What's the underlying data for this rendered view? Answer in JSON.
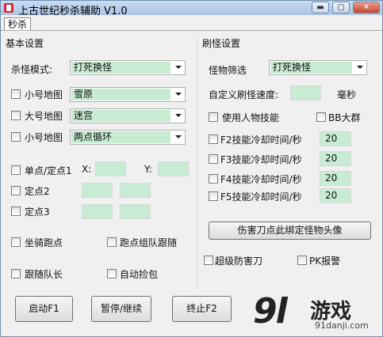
{
  "window": {
    "title": "上古世纪秒杀辅助 V1.0",
    "min": "▬",
    "max": "▢",
    "close": "✕"
  },
  "tab": {
    "label": "秒杀"
  },
  "left": {
    "title": "基本设置",
    "kill_mode_label": "杀怪模式:",
    "kill_mode_value": "打死换怪",
    "maps": [
      {
        "label": "小号地图",
        "value": "雪原"
      },
      {
        "label": "大号地图",
        "value": "迷宫"
      },
      {
        "label": "小号地图",
        "value": "两点循环"
      }
    ],
    "point_options": [
      {
        "label": "单点/定点1",
        "x_label": "X:",
        "y_label": "Y:"
      },
      {
        "label": "定点2"
      },
      {
        "label": "定点3"
      }
    ],
    "mount_run": "坐骑跑点",
    "team_follow_run": "跑点组队跟随",
    "follow_leader": "跟随队长",
    "auto_loot": "自动捡包"
  },
  "right": {
    "title": "刷怪设置",
    "filter_label": "怪物筛选",
    "filter_value": "打死换怪",
    "custom_speed_label": "自定义刷怪速度:",
    "custom_speed_unit": "毫秒",
    "use_skills": "使用人物技能",
    "bb_group": "BB大群",
    "skills": [
      {
        "label": "F2技能冷却时间/秒",
        "value": "20"
      },
      {
        "label": "F3技能冷却时间/秒",
        "value": "20"
      },
      {
        "label": "F4技能冷却时间/秒",
        "value": "20"
      },
      {
        "label": "F5技能冷却时间/秒",
        "value": "20"
      }
    ],
    "bind_button": "伤害刀点此绑定怪物头像",
    "super_damage": "超级防害刀",
    "pk_alarm": "PK报警"
  },
  "buttons": {
    "start": "启动F1",
    "pause": "暂停/继续",
    "stop": "终止F2"
  },
  "watermark": {
    "mark": "9l",
    "name": "游戏",
    "url": "91danji.com"
  }
}
